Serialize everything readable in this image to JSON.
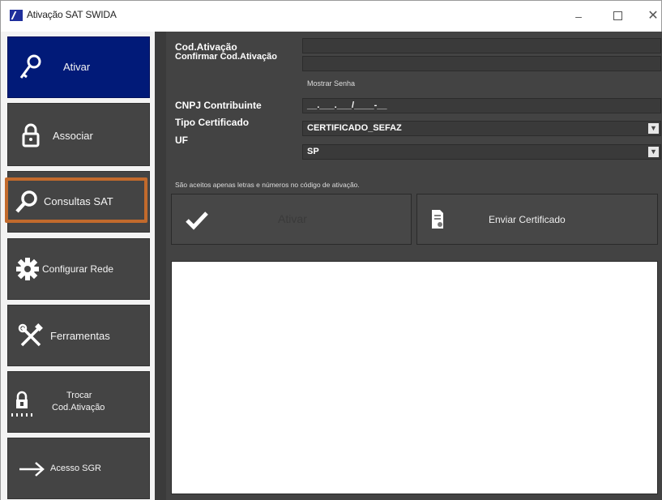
{
  "window": {
    "title": "Ativação SAT SWIDA",
    "minimize_glyph": "–",
    "close_glyph": "✕"
  },
  "sidebar": {
    "items": [
      {
        "label": "Ativar",
        "icon": "key-icon"
      },
      {
        "label": "Associar",
        "icon": "lock-icon"
      },
      {
        "label": "Consultas SAT",
        "icon": "magnifier-icon"
      },
      {
        "label": "Configurar Rede",
        "icon": "gear-icon"
      },
      {
        "label": "Ferramentas",
        "icon": "tools-icon"
      },
      {
        "label_line1": "Trocar",
        "label_line2": "Cod.Ativação",
        "icon": "lock-password-icon"
      },
      {
        "label": "Acesso SGR",
        "icon": "arrow-right-icon"
      }
    ],
    "active_color": "#011a78",
    "highlight_color": "#c26a2c"
  },
  "form": {
    "cod_ativacao_label": "Cod.Ativação",
    "cod_ativacao_value": "",
    "confirmar_label": "Confirmar Cod.Ativação",
    "confirmar_value": "",
    "mostrar_senha_label": "Mostrar Senha",
    "cnpj_label": "CNPJ Contribuinte",
    "cnpj_value": "__.___.___/____-__",
    "tipo_certificado_label": "Tipo Certificado",
    "tipo_certificado_value": "CERTIFICADO_SEFAZ",
    "uf_label": "UF",
    "uf_value": "SP",
    "hint": "São aceitos apenas letras e números no código de ativação."
  },
  "actions": {
    "ativar_label": "Ativar",
    "enviar_certificado_label": "Enviar Certificado"
  },
  "output": {
    "text": ""
  }
}
